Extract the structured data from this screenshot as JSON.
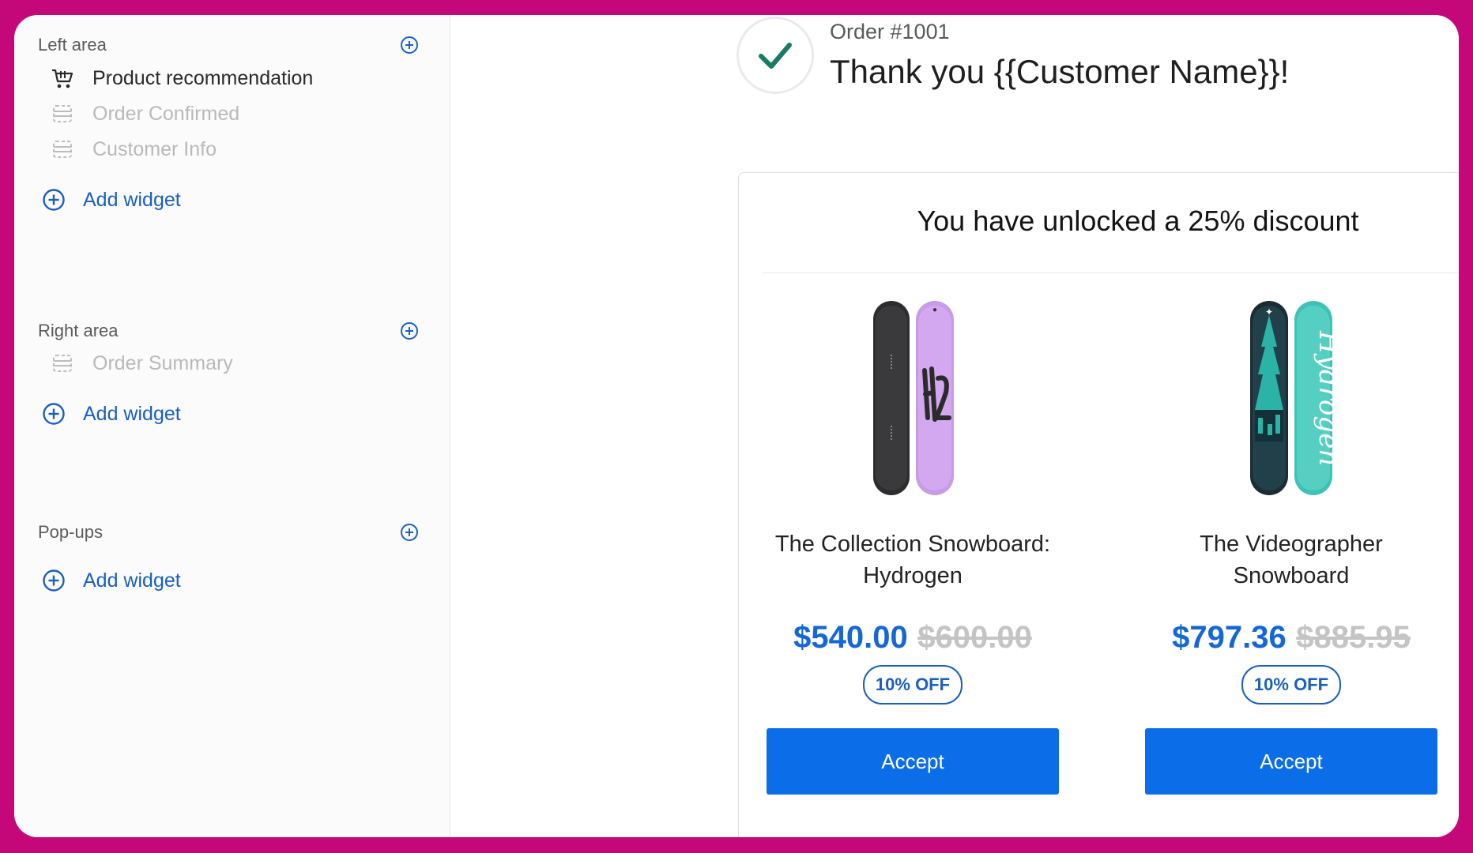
{
  "sidebar": {
    "left_area": {
      "title": "Left area",
      "items": [
        {
          "label": "Product recommendation",
          "icon": "cart-icon",
          "state": "active"
        },
        {
          "label": "Order Confirmed",
          "icon": "block-icon",
          "state": "muted"
        },
        {
          "label": "Customer Info",
          "icon": "block-icon",
          "state": "muted"
        }
      ],
      "add_label": "Add widget"
    },
    "right_area": {
      "title": "Right area",
      "items": [
        {
          "label": "Order Summary",
          "icon": "block-icon",
          "state": "muted"
        }
      ],
      "add_label": "Add widget"
    },
    "popups": {
      "title": "Pop-ups",
      "add_label": "Add widget"
    }
  },
  "preview": {
    "order_number": "Order #1001",
    "thank_you": "Thank you {{Customer Name}}!",
    "upsell": {
      "title": "You have unlocked a 25% discount",
      "products": [
        {
          "name": "The Collection Snowboard: Hydrogen",
          "price": "$540.00",
          "compare_price": "$600.00",
          "badge": "10% OFF",
          "button": "Accept"
        },
        {
          "name": "The Videographer Snowboard",
          "price": "$797.36",
          "compare_price": "$885.95",
          "badge": "10% OFF",
          "button": "Accept"
        }
      ]
    }
  },
  "colors": {
    "frame_border": "#c4087a",
    "accent_blue": "#1567d4",
    "button_blue": "#0c6de8",
    "check_green": "#1a7a63"
  }
}
